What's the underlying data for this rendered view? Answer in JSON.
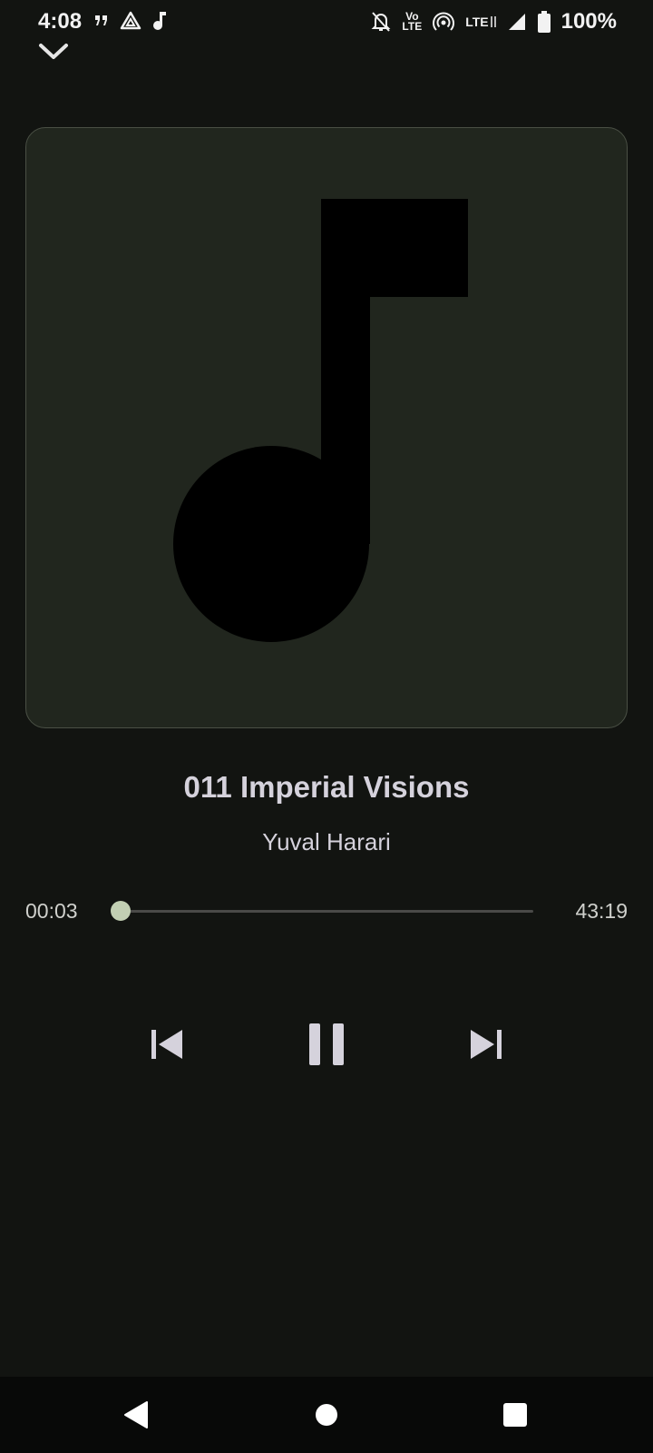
{
  "status_bar": {
    "time": "4:08",
    "volte_top": "Vo",
    "volte_bottom": "LTE",
    "lte_label": "LTE",
    "battery_text": "100%",
    "icons": [
      "quote-notification-icon",
      "drive-icon",
      "music-note-notification-icon",
      "bell-off-icon",
      "volte-icon",
      "hotspot-icon",
      "lte-icon",
      "signal-icon",
      "battery-icon"
    ]
  },
  "header": {
    "collapse_icon": "chevron-down-icon"
  },
  "album_art": {
    "placeholder_icon": "music-note-icon",
    "background": "#21261e",
    "border": "#4a5045"
  },
  "track": {
    "title": "011 Imperial Visions",
    "artist": "Yuval Harari"
  },
  "progress": {
    "elapsed": "00:03",
    "total": "43:19",
    "fraction": 0.0012,
    "accent": "#c2cfb3"
  },
  "controls": {
    "previous_icon": "skip-previous-icon",
    "pause_icon": "pause-icon",
    "next_icon": "skip-next-icon",
    "color": "#d5d2dc"
  },
  "nav_bar": {
    "back_icon": "back-triangle-icon",
    "home_icon": "home-circle-icon",
    "recents_icon": "recents-square-icon"
  }
}
